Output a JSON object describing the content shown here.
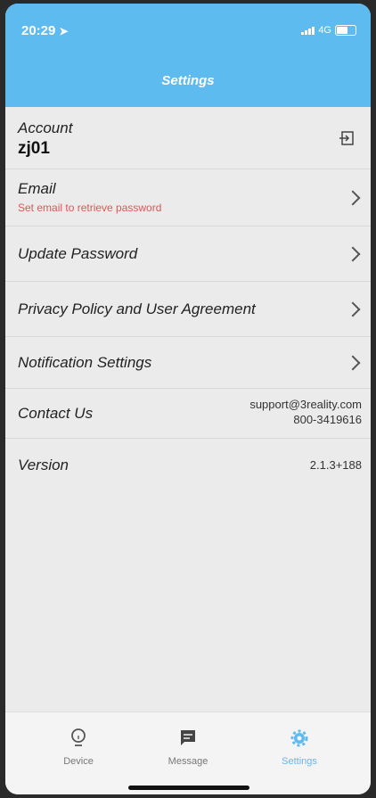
{
  "status_bar": {
    "time": "20:29",
    "network": "4G"
  },
  "header": {
    "title": "Settings"
  },
  "account": {
    "label": "Account",
    "username": "zj01"
  },
  "email": {
    "label": "Email",
    "hint": "Set email to retrieve password"
  },
  "update_password": {
    "label": "Update Password"
  },
  "privacy": {
    "label": "Privacy Policy and User Agreement"
  },
  "notifications": {
    "label": "Notification Settings"
  },
  "contact": {
    "label": "Contact Us",
    "email": "support@3reality.com",
    "phone": "800-3419616"
  },
  "version": {
    "label": "Version",
    "value": "2.1.3+188"
  },
  "tabs": [
    {
      "label": "Device",
      "icon": "lightbulb-icon"
    },
    {
      "label": "Message",
      "icon": "chat-icon"
    },
    {
      "label": "Settings",
      "icon": "gear-icon"
    }
  ],
  "colors": {
    "accent": "#5dbbf0",
    "warning": "#e05555"
  }
}
